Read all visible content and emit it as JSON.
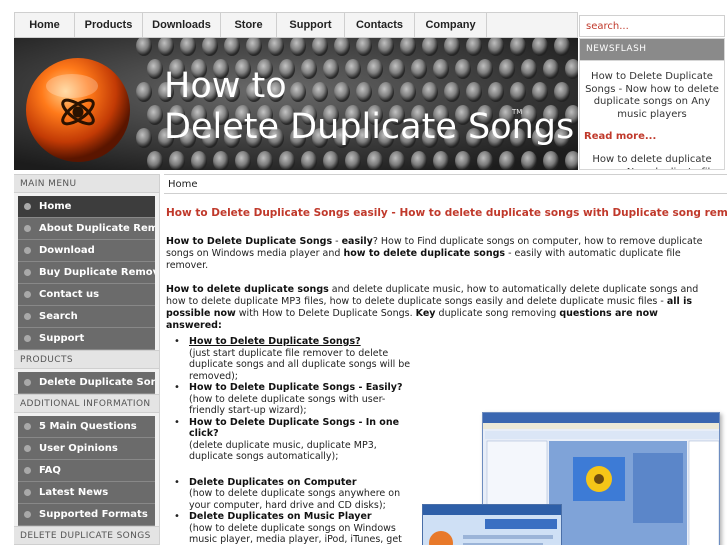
{
  "topnav": {
    "items": [
      "Home",
      "Products",
      "Downloads",
      "Store",
      "Support",
      "Contacts",
      "Company"
    ]
  },
  "search": {
    "placeholder": "search..."
  },
  "banner": {
    "title_line1": "How to",
    "title_line2": "Delete Duplicate Songs",
    "tm": "TM"
  },
  "newsflash": {
    "heading": "NEWSFLASH",
    "item1": "How to Delete Duplicate Songs - Now how to delete duplicate songs on Any music players",
    "read_more": "Read more...",
    "item2": "How to delete duplicate songs - New duplicate file removing"
  },
  "sidebar": {
    "main_menu_heading": "MAIN MENU",
    "main_menu": [
      "Home",
      "About Duplicate Remover",
      "Download",
      "Buy Duplicate Remover",
      "Contact us",
      "Search",
      "Support"
    ],
    "products_heading": "PRODUCTS",
    "products": [
      "Delete Duplicate Songs"
    ],
    "additional_heading": "ADDITIONAL INFORMATION",
    "additional": [
      "5 Main Questions",
      "User Opinions",
      "FAQ",
      "Latest News",
      "Supported Formats"
    ],
    "delete_heading": "DELETE DUPLICATE SONGS"
  },
  "content": {
    "breadcrumb": "Home",
    "headline": "How to Delete Duplicate Songs easily - How to delete duplicate songs with Duplicate song remover",
    "p1": {
      "b1": "How to Delete Duplicate Songs",
      "t1": " - ",
      "b2": "easily",
      "t2": "? How to Find duplicate songs on computer, how to remove duplicate songs on Windows media player and ",
      "b3": "how to delete duplicate songs",
      "t3": " - easily with automatic duplicate file remover."
    },
    "p2": {
      "b1": "How to delete duplicate songs",
      "t1": " and delete duplicate music, how to automatically delete duplicate songs and how to delete duplicate MP3 files, how to delete duplicate songs easily and delete duplicate music files - ",
      "b2": "all is possible now",
      "t2": " with How to Delete Duplicate Songs. ",
      "b3": "Key",
      "t3": " duplicate song removing ",
      "b4": "questions are now answered:"
    },
    "features": [
      {
        "title": "How to Delete Duplicate Songs?",
        "desc": "(just start duplicate file remover to delete duplicate songs and all duplicate songs will be removed);"
      },
      {
        "title": "How to Delete Duplicate Songs - Easily?",
        "desc": "(how to delete duplicate songs with user-friendly start-up wizard);"
      },
      {
        "title": "How to Delete Duplicate Songs - In one click?",
        "desc": "(delete duplicate music, duplicate MP3, duplicate songs automatically);"
      },
      {
        "title": "Delete Duplicates on Computer",
        "desc": "(how to delete duplicate songs anywhere on your computer, hard drive and CD disks);"
      },
      {
        "title": "Delete Duplicates on Music Player",
        "desc": "(how to delete duplicate songs on Windows music player, media player, iPod, iTunes, get no duplicate songs at your home);"
      }
    ]
  },
  "colors": {
    "accent": "#c0392b",
    "menu_bg": "#6b6b6b",
    "menu_active": "#3d3d3d"
  }
}
